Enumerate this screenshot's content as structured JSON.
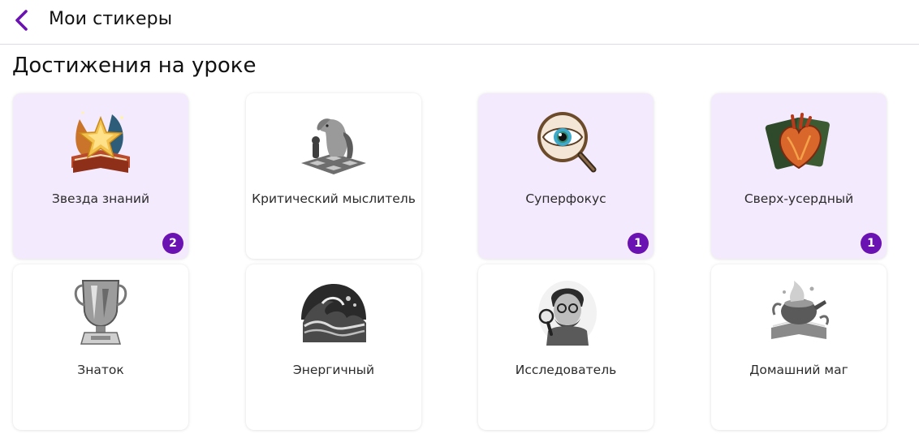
{
  "header": {
    "title": "Мои стикеры",
    "back_icon": "chevron-left-icon",
    "accent_color": "#6a12b2"
  },
  "section": {
    "title": "Достижения на уроке"
  },
  "stickers": [
    {
      "name": "Звезда знаний",
      "count": "2",
      "earned": true,
      "icon": "star-book-icon"
    },
    {
      "name": "Критический мыслитель",
      "count": "",
      "earned": false,
      "icon": "chess-horse-icon"
    },
    {
      "name": "Суперфокус",
      "count": "1",
      "earned": true,
      "icon": "eye-magnifier-icon"
    },
    {
      "name": "Сверх-усердный",
      "count": "1",
      "earned": true,
      "icon": "heart-icon"
    },
    {
      "name": "Знаток",
      "count": "",
      "earned": false,
      "icon": "trophy-icon"
    },
    {
      "name": "Энергичный",
      "count": "",
      "earned": false,
      "icon": "wave-icon"
    },
    {
      "name": "Исследователь",
      "count": "",
      "earned": false,
      "icon": "explorer-icon"
    },
    {
      "name": "Домашний маг",
      "count": "",
      "earned": false,
      "icon": "potion-book-icon"
    }
  ],
  "colors": {
    "earned_card_bg": "#f4eafd",
    "badge_bg": "#6a12b2"
  }
}
